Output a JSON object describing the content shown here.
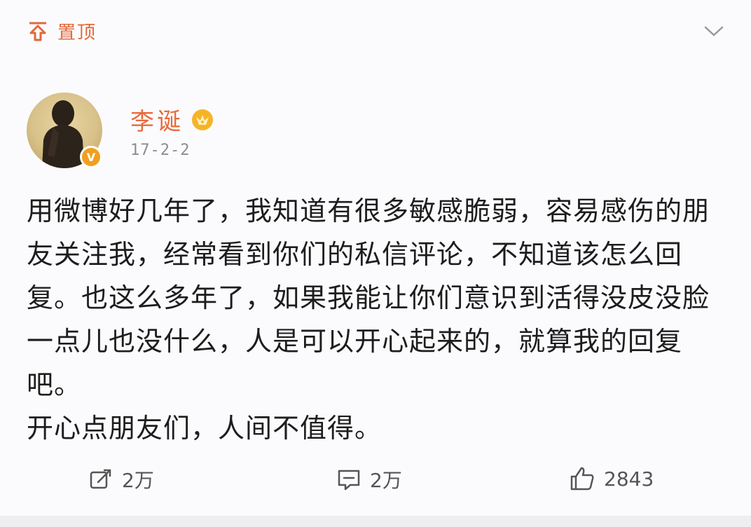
{
  "header": {
    "pin_label": "置顶",
    "pin_icon": "pin-icon",
    "more_icon": "chevron-down-icon"
  },
  "author": {
    "name": "李诞",
    "vip_icon": "vip-crown-icon",
    "verified_icon": "verified-badge-icon",
    "verified_mark": "V",
    "date": "17-2-2"
  },
  "post": {
    "paragraphs": [
      "用微博好几年了，我知道有很多敏感脆弱，容易感伤的朋友关注我，经常看到你们的私信评论，不知道该怎么回复。也这么多年了，如果我能让你们意识到活得没皮没脸一点儿也没什么，人是可以开心起来的，就算我的回复吧。",
      "开心点朋友们，人间不值得。"
    ]
  },
  "actions": {
    "repost": {
      "icon": "repost-icon",
      "count": "2万"
    },
    "comment": {
      "icon": "comment-icon",
      "count": "2万"
    },
    "like": {
      "icon": "thumbs-up-icon",
      "count": "2843"
    }
  },
  "colors": {
    "accent": "#e86a3a",
    "verified": "#f0a020",
    "text": "#1d1d1d",
    "muted": "#8d8d8d"
  }
}
